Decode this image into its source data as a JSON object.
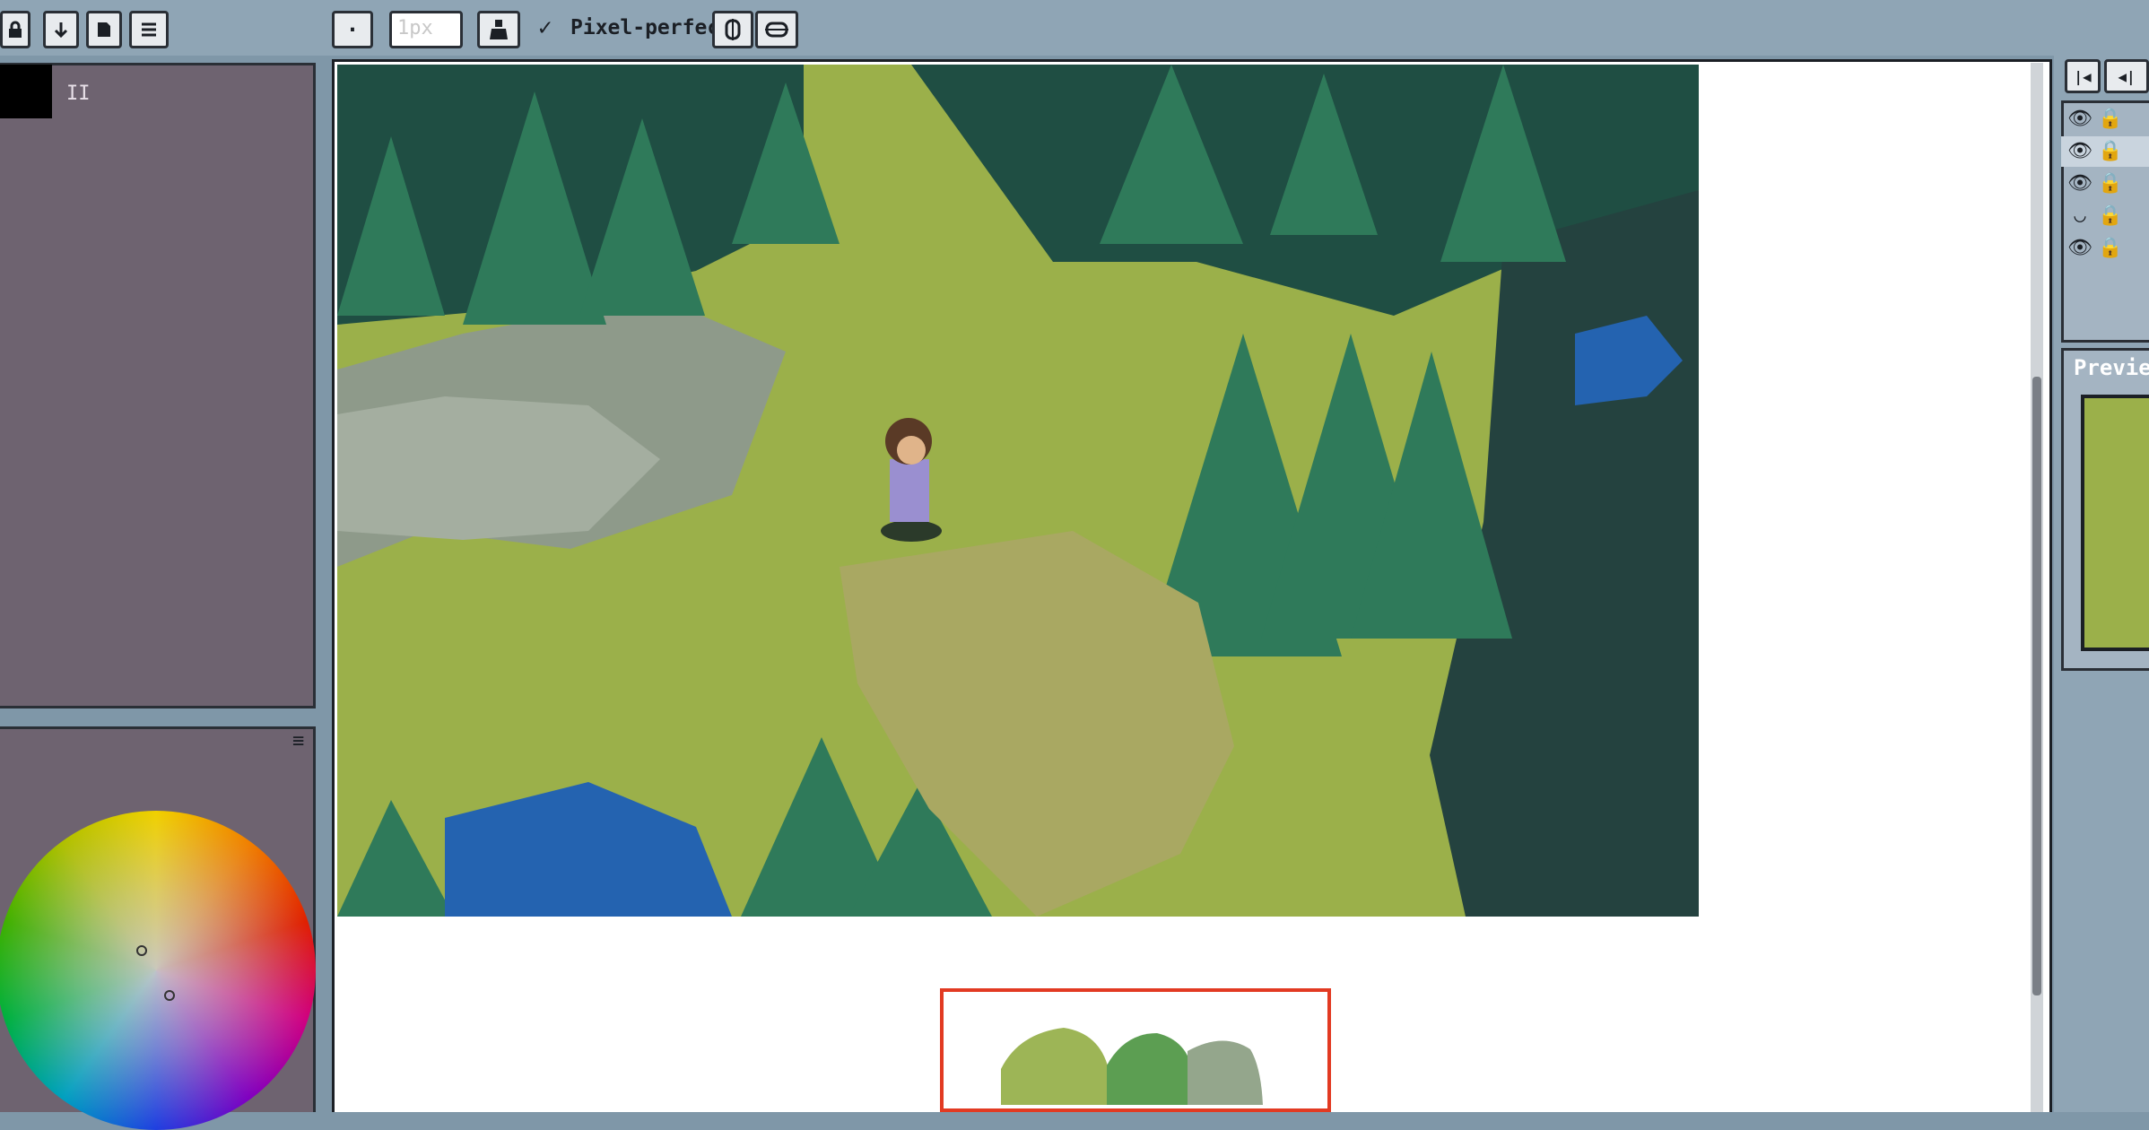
{
  "toolbar": {
    "lock_icon": "lock-icon",
    "down_icon": "arrow-down-icon",
    "doc_icon": "document-icon",
    "menu_icon": "menu-icon",
    "dot_label": "·",
    "brush_size": "1px",
    "ink_icon": "ink-bottle-icon",
    "pixel_perfect_check": "✓",
    "pixel_perfect_label": "Pixel-perfect",
    "symmetry_v_icon": "symmetry-vertical-icon",
    "symmetry_h_icon": "symmetry-horizontal-icon"
  },
  "left_panel": {
    "frame_marker": "II",
    "palette_menu": "≡"
  },
  "right_panel": {
    "nav_first": "|◀",
    "nav_prev": "◀|",
    "preview_title": "Previe"
  },
  "colors": {
    "accent_selection": "#e23a22",
    "panel_bg": "#6e6370",
    "toolbar_bg": "#8fa5b5"
  }
}
